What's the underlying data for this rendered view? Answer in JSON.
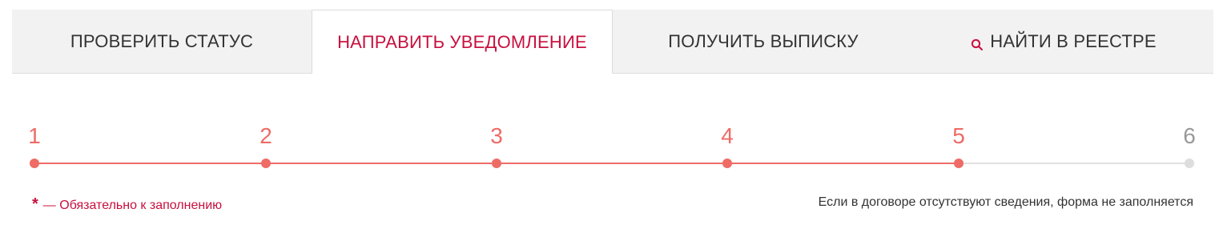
{
  "tabs": [
    {
      "label": "ПРОВЕРИТЬ СТАТУС",
      "active": false
    },
    {
      "label": "НАПРАВИТЬ УВЕДОМЛЕНИЕ",
      "active": true
    },
    {
      "label": "ПОЛУЧИТЬ ВЫПИСКУ",
      "active": false
    },
    {
      "label": "НАЙТИ В РЕЕСТРЕ",
      "active": false,
      "icon": "search-icon"
    }
  ],
  "stepper": {
    "steps": [
      "1",
      "2",
      "3",
      "4",
      "5",
      "6"
    ],
    "current_step": 5,
    "total_steps": 6
  },
  "notes": {
    "required_star": "*",
    "required_text": "— Обязательно к заполнению",
    "info_text": "Если в договоре отсутствуют сведения, форма не заполняется"
  },
  "colors": {
    "accent": "#c8103e",
    "step_active": "#ee6b66",
    "step_inactive": "#999999",
    "tab_bg": "#f2f2f2"
  }
}
